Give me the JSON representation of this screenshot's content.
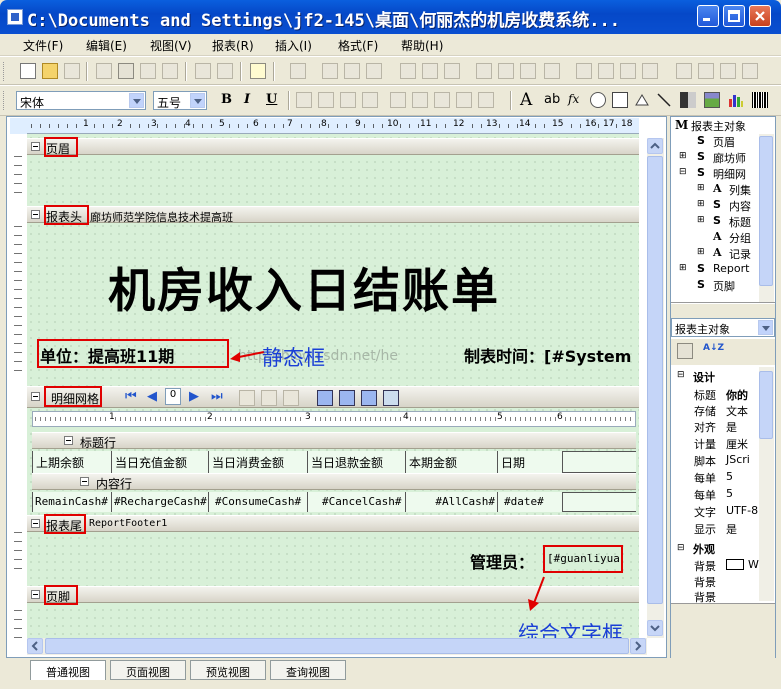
{
  "window": {
    "title": "C:\\Documents and Settings\\jf2-145\\桌面\\何丽杰的机房收费系统..."
  },
  "menu": [
    "文件(F)",
    "编辑(E)",
    "视图(V)",
    "报表(R)",
    "插入(I)",
    "格式(F)",
    "帮助(H)"
  ],
  "format_bar": {
    "font": "宋体",
    "size": "五号",
    "bold": "B",
    "italic": "I",
    "underline": "U",
    "text_icon": "A",
    "ab_icon": "ab",
    "fx_icon": "fx"
  },
  "ruler": {
    "numbers": [
      "1",
      "2",
      "3",
      "4",
      "5",
      "6",
      "7",
      "8",
      "9",
      "10",
      "11",
      "12",
      "13",
      "14",
      "15",
      "16",
      "17",
      "18"
    ]
  },
  "bands": {
    "page_header": "页眉",
    "report_header": "报表头",
    "report_header_extra": "廊坊师范学院信息技术提高班",
    "detail_grid": "明细网格",
    "report_footer": "报表尾",
    "report_footer_extra": "ReportFooter1",
    "page_footer": "页脚"
  },
  "report": {
    "title": "机房收入日结账单",
    "unit_label": "单位：提高班11期",
    "time_label": "制表时间：[#System",
    "manager_label": "管理员：",
    "manager_field": "[#guanliyua",
    "watermark": "http://blog.csdn.net/he",
    "nav_page": "0"
  },
  "annotations": {
    "static_box": "静态框",
    "composite_box": "综合文字框"
  },
  "grid": {
    "title_row_label": "标题行",
    "content_row_label": "内容行",
    "ruler_nums": [
      "1",
      "2",
      "3",
      "4",
      "5",
      "6"
    ],
    "headers": [
      "上期余额",
      "当日充值金额",
      "当日消费金额",
      "当日退款金额",
      "本期金额",
      "日期"
    ],
    "cells": [
      "RemainCash#",
      "#RechargeCash#",
      "#ConsumeCash#",
      "#CancelCash#",
      "#AllCash#",
      "#date#"
    ]
  },
  "tree": {
    "root": "报表主对象",
    "items": [
      "页眉",
      "廊坊师",
      "明细网",
      "列集",
      "内容",
      "标题",
      "分组",
      "记录",
      "Report",
      "页脚"
    ]
  },
  "properties": {
    "object_select": "报表主对象",
    "sections": {
      "design": "设计",
      "appearance": "外观"
    },
    "rows": [
      {
        "name": "标题",
        "value": "你的"
      },
      {
        "name": "存储",
        "value": "文本"
      },
      {
        "name": "对齐",
        "value": "是"
      },
      {
        "name": "计量",
        "value": "厘米"
      },
      {
        "name": "脚本",
        "value": "JScri"
      },
      {
        "name": "每单",
        "value": "5"
      },
      {
        "name": "每单",
        "value": "5"
      },
      {
        "name": "文字",
        "value": "UTF-8"
      },
      {
        "name": "显示",
        "value": "是"
      }
    ],
    "appearance_rows": [
      {
        "name": "背景",
        "value": "W"
      },
      {
        "name": "背景",
        "value": ""
      },
      {
        "name": "背景",
        "value": ""
      }
    ],
    "sort_alpha_icon": "A↓Z"
  },
  "tabs": [
    "普通视图",
    "页面视图",
    "预览视图",
    "查询视图"
  ],
  "colors": {
    "annotation_blue": "#1a3fd6",
    "red_box": "#e00000",
    "canvas_green": "#d8f0d8",
    "title_blue": "#0548c8"
  }
}
